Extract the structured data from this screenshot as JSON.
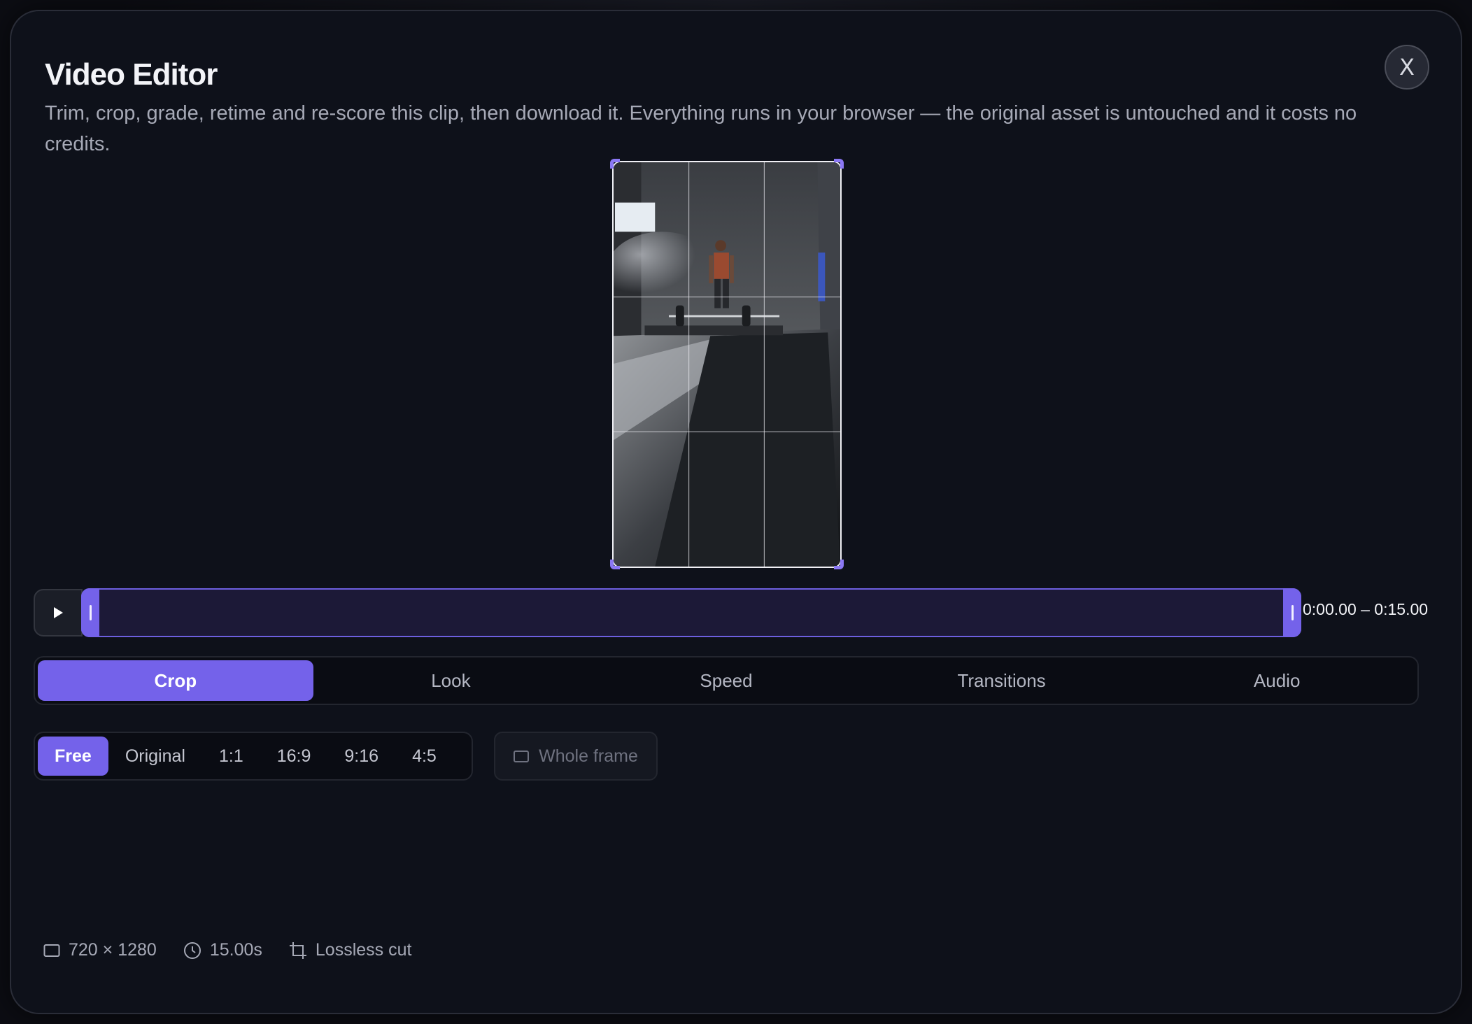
{
  "modal": {
    "title": "Video Editor",
    "subtitle": "Trim, crop, grade, retime and re-score this clip, then download it. Everything runs in your browser — the original asset is untouched and it costs no credits.",
    "close_label": "X"
  },
  "timeline": {
    "range_label": "0:00.00 – 0:15.00",
    "trim_start_fraction": 0.0,
    "trim_end_fraction": 1.0
  },
  "tabs": [
    {
      "label": "Crop",
      "active": true
    },
    {
      "label": "Look",
      "active": false
    },
    {
      "label": "Speed",
      "active": false
    },
    {
      "label": "Transitions",
      "active": false
    },
    {
      "label": "Audio",
      "active": false
    }
  ],
  "aspect_ratios": [
    {
      "label": "Free",
      "active": true
    },
    {
      "label": "Original",
      "active": false
    },
    {
      "label": "1:1",
      "active": false
    },
    {
      "label": "16:9",
      "active": false
    },
    {
      "label": "9:16",
      "active": false
    },
    {
      "label": "4:5",
      "active": false
    }
  ],
  "whole_frame_label": "Whole frame",
  "footer": {
    "resolution": "720 × 1280",
    "duration": "15.00s",
    "mode": "Lossless cut"
  },
  "colors": {
    "accent": "#7462ea",
    "background": "#0e111a"
  }
}
